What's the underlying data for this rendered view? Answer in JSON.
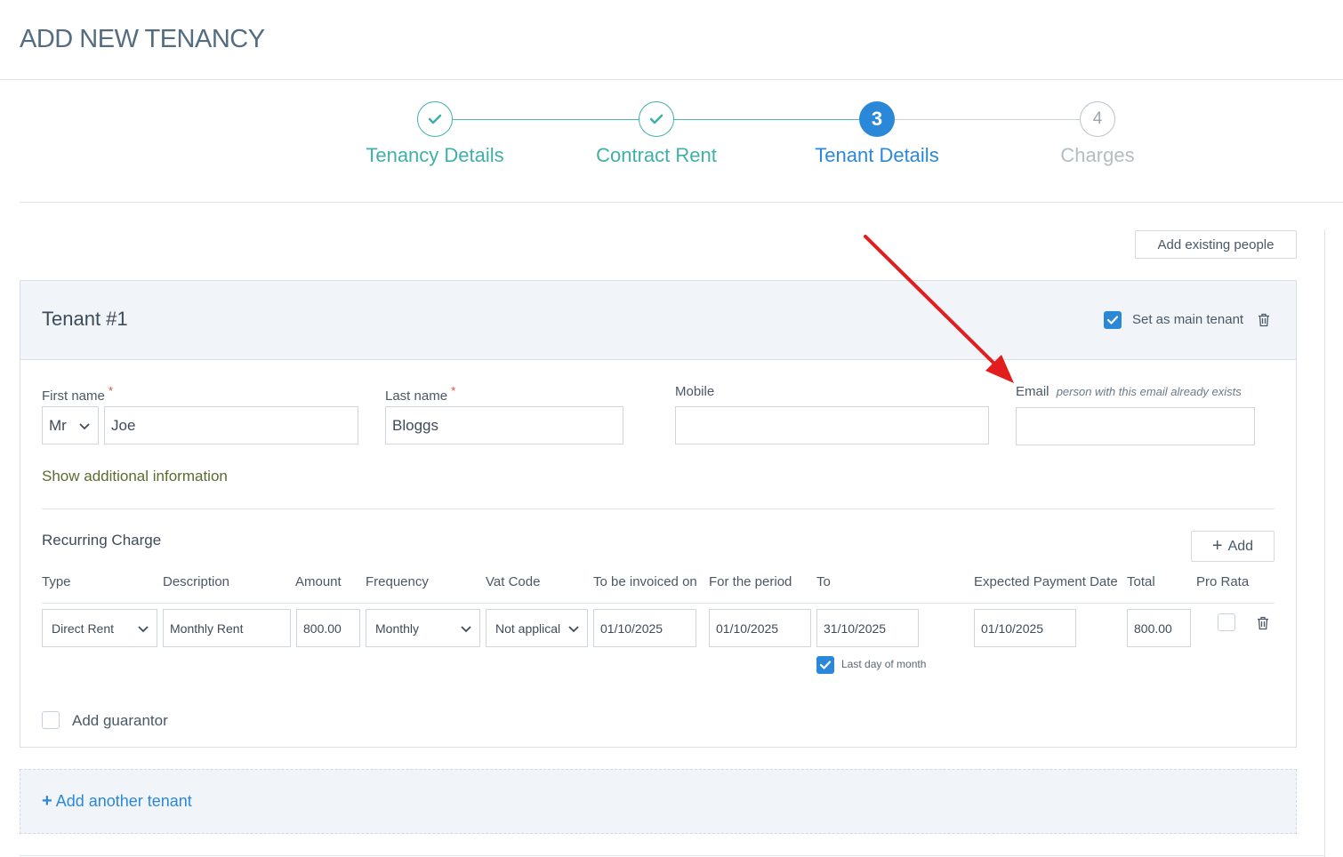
{
  "page": {
    "title": "ADD NEW TENANCY"
  },
  "stepper": {
    "steps": [
      {
        "label": "Tenancy Details",
        "state": "done",
        "marker": ""
      },
      {
        "label": "Contract Rent",
        "state": "done",
        "marker": ""
      },
      {
        "label": "Tenant Details",
        "state": "active",
        "marker": "3"
      },
      {
        "label": "Charges",
        "state": "todo",
        "marker": "4"
      }
    ]
  },
  "toolbar": {
    "add_existing_label": "Add existing people"
  },
  "tenant": {
    "title": "Tenant #1",
    "main_tenant_label": "Set as main tenant",
    "main_tenant_checked": true,
    "first_name_label": "First name",
    "last_name_label": "Last name",
    "mobile_label": "Mobile",
    "email_label": "Email",
    "email_note": "person with this email already exists",
    "required_mark": "*",
    "title_value": "Mr",
    "first_name_value": "Joe",
    "last_name_value": "Bloggs",
    "mobile_value": "",
    "email_value": "",
    "show_more_label": "Show additional information"
  },
  "recurring": {
    "title": "Recurring Charge",
    "add_label": "Add",
    "columns": [
      "Type",
      "Description",
      "Amount",
      "Frequency",
      "Vat Code",
      "To be invoiced on",
      "For the period",
      "To",
      "Expected Payment Date",
      "Total",
      "Pro Rata"
    ],
    "row": {
      "type": "Direct Rent",
      "description": "Monthly Rent",
      "amount": "800.00",
      "frequency": "Monthly",
      "vat_code": "Not applical",
      "invoiced_on": "01/10/2025",
      "period_from": "01/10/2025",
      "period_to": "31/10/2025",
      "expected_payment": "01/10/2025",
      "total": "800.00",
      "pro_rata": false
    },
    "last_day_label": "Last day of month",
    "last_day_checked": true
  },
  "guarantor": {
    "label": "Add guarantor",
    "checked": false
  },
  "footer": {
    "add_tenant_label": "Add another tenant"
  },
  "colors": {
    "accent_blue": "#2b88d8",
    "done_teal": "#3fb0a8",
    "annotation_red": "#e11d1d"
  }
}
